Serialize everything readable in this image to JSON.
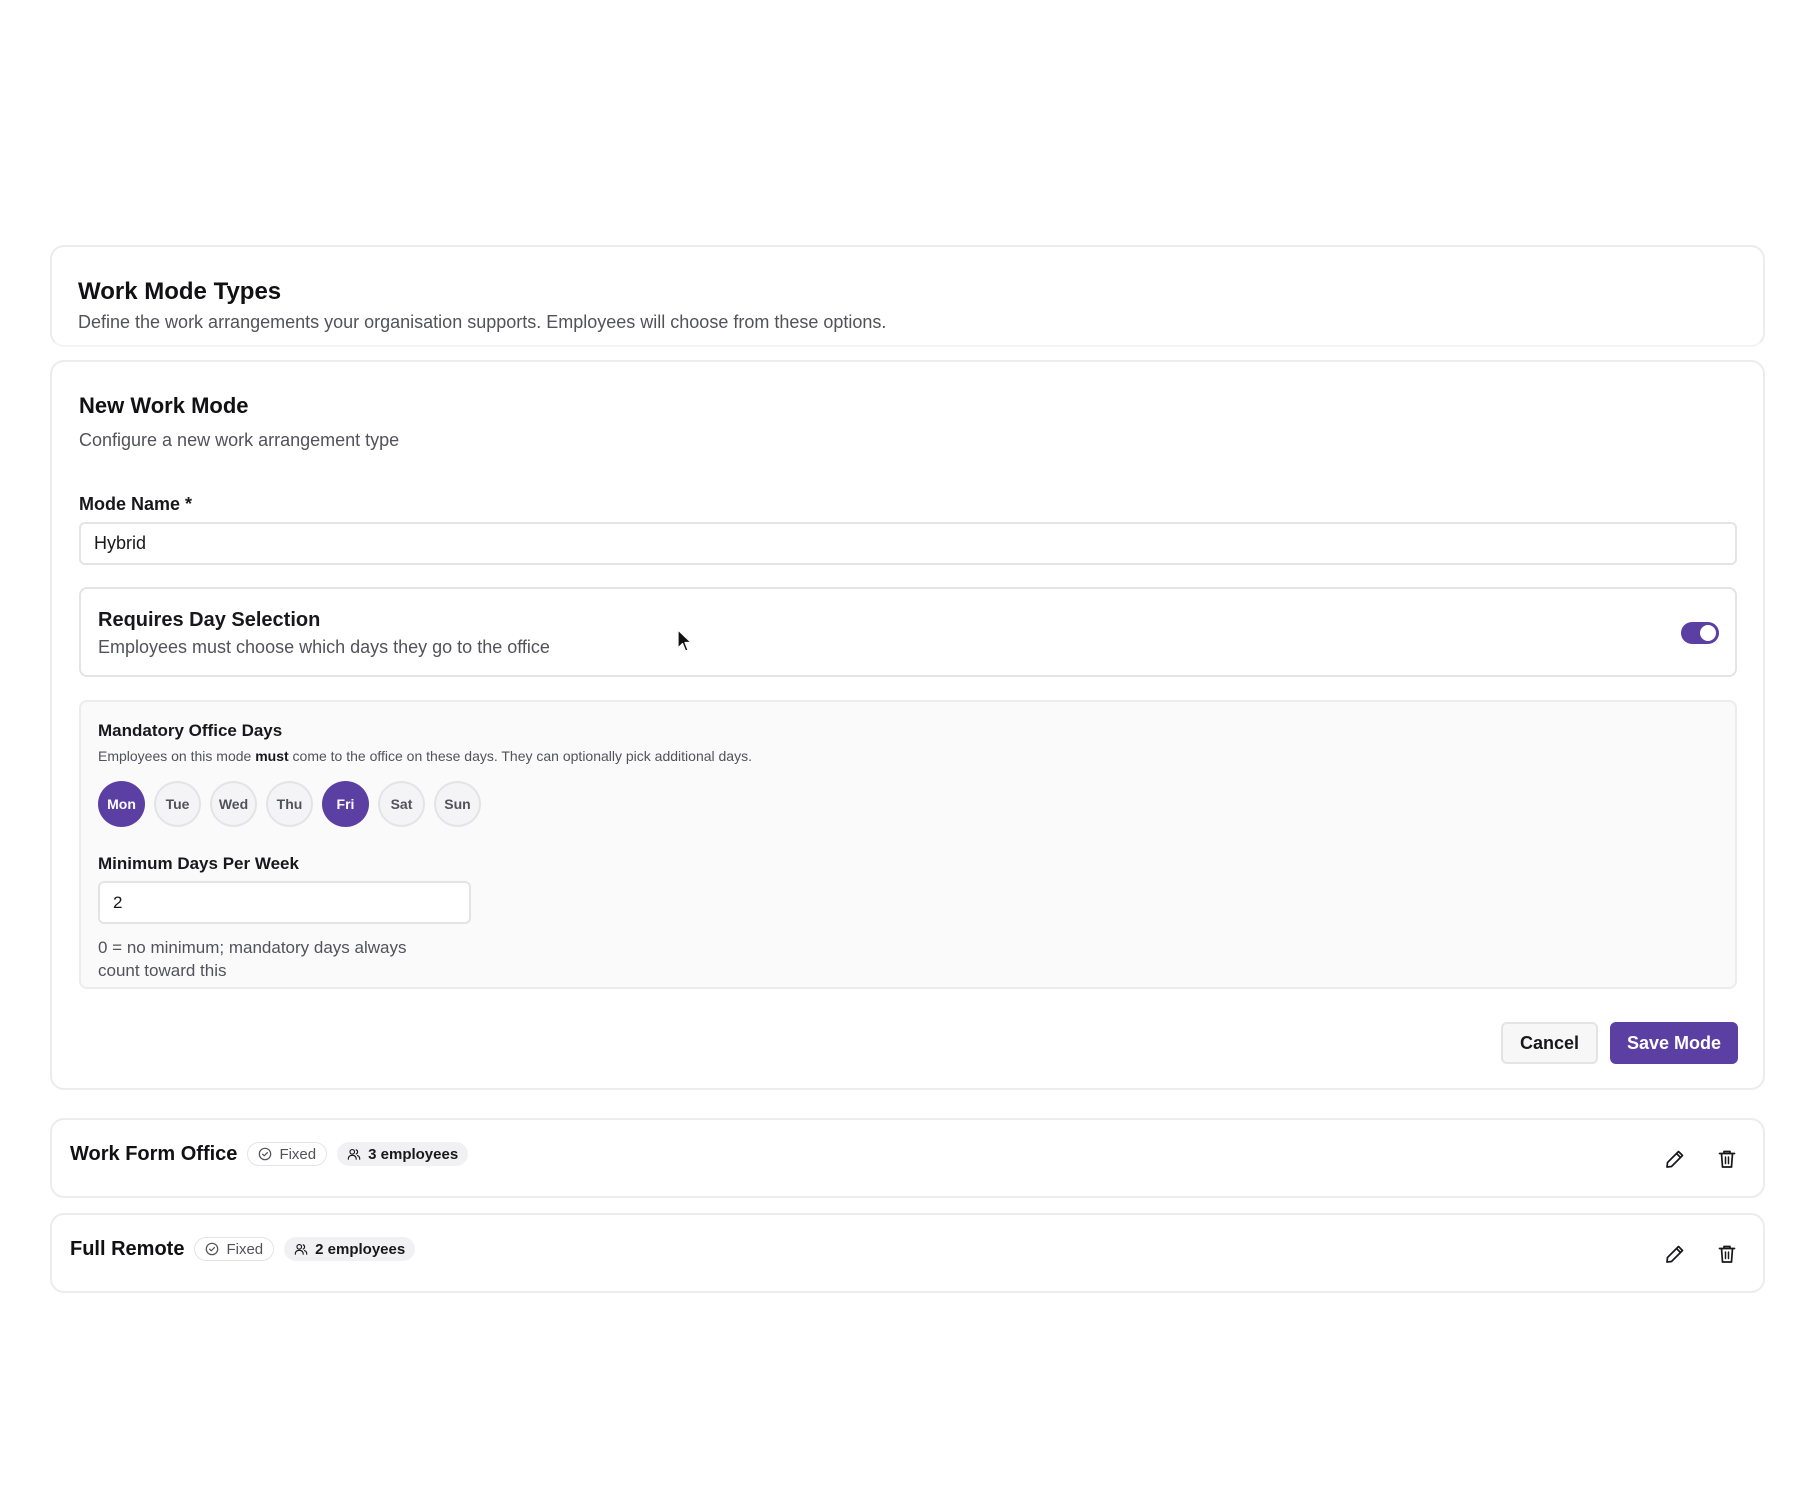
{
  "header": {
    "title": "Work Mode Types",
    "subtitle": "Define the work arrangements your organisation supports. Employees will choose from these options."
  },
  "form": {
    "title": "New Work Mode",
    "subtitle": "Configure a new work arrangement type",
    "mode_name_label": "Mode Name *",
    "mode_name_value": "Hybrid",
    "day_selection": {
      "title": "Requires Day Selection",
      "description": "Employees must choose which days they go to the office",
      "enabled": true
    },
    "office_days": {
      "title": "Mandatory Office Days",
      "desc_before": "Employees on this mode ",
      "desc_bold": "must",
      "desc_after": " come to the office on these days. They can optionally pick additional days.",
      "days": [
        {
          "label": "Mon",
          "selected": true
        },
        {
          "label": "Tue",
          "selected": false
        },
        {
          "label": "Wed",
          "selected": false
        },
        {
          "label": "Thu",
          "selected": false
        },
        {
          "label": "Fri",
          "selected": true
        },
        {
          "label": "Sat",
          "selected": false
        },
        {
          "label": "Sun",
          "selected": false
        }
      ],
      "min_days_label": "Minimum Days Per Week",
      "min_days_value": "2",
      "min_days_hint": "0 = no minimum; mandatory days always count toward this"
    },
    "cancel_label": "Cancel",
    "save_label": "Save Mode"
  },
  "modes": [
    {
      "name": "Work Form Office",
      "type_badge": "Fixed",
      "employees_badge": "3 employees"
    },
    {
      "name": "Full Remote",
      "type_badge": "Fixed",
      "employees_badge": "2 employees"
    }
  ],
  "icons": {
    "badge_type": "check-circle-icon",
    "badge_employees": "users-icon",
    "edit": "pencil-icon",
    "delete": "trash-icon"
  },
  "colors": {
    "accent": "#5b3fa3",
    "border": "#e4e4e7",
    "muted_text": "#52525b"
  }
}
